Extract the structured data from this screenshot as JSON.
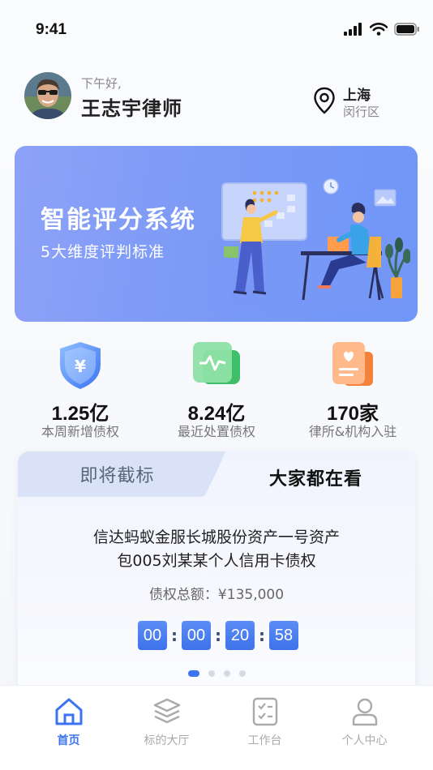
{
  "status_bar": {
    "time": "9:41"
  },
  "header": {
    "greeting": "下午好,",
    "name": "王志宇律师",
    "location": {
      "city": "上海",
      "district": "闵行区"
    }
  },
  "banner": {
    "title": "智能评分系统",
    "subtitle": "5大维度评判标准"
  },
  "stats": [
    {
      "value": "1.25亿",
      "label": "本周新增债权",
      "icon": "shield-yen-icon"
    },
    {
      "value": "8.24亿",
      "label": "最近处置债权",
      "icon": "pulse-card-icon"
    },
    {
      "value": "170家",
      "label": "律所&机构入驻",
      "icon": "document-heart-icon"
    }
  ],
  "card": {
    "tabs": [
      {
        "label": "即将截标",
        "active": false
      },
      {
        "label": "大家都在看",
        "active": true
      }
    ],
    "item": {
      "title_line1": "信达蚂蚁金服长城股份资产一号资产",
      "title_line2": "包005刘某某个人信用卡债权",
      "amount": "债权总额：¥135,000"
    },
    "countdown": [
      "00",
      "00",
      "20",
      "58"
    ],
    "separator": ":",
    "pager": {
      "count": 4,
      "active": 0
    }
  },
  "bottom_nav": [
    {
      "label": "首页",
      "icon": "home-icon",
      "active": true
    },
    {
      "label": "标的大厅",
      "icon": "layers-icon",
      "active": false
    },
    {
      "label": "工作台",
      "icon": "checklist-icon",
      "active": false
    },
    {
      "label": "个人中心",
      "icon": "user-icon",
      "active": false
    }
  ],
  "colors": {
    "accent": "#3b73f0",
    "banner_start": "#8da2f8",
    "banner_end": "#6f96f8",
    "inactive_nav": "#aaaaaa"
  }
}
